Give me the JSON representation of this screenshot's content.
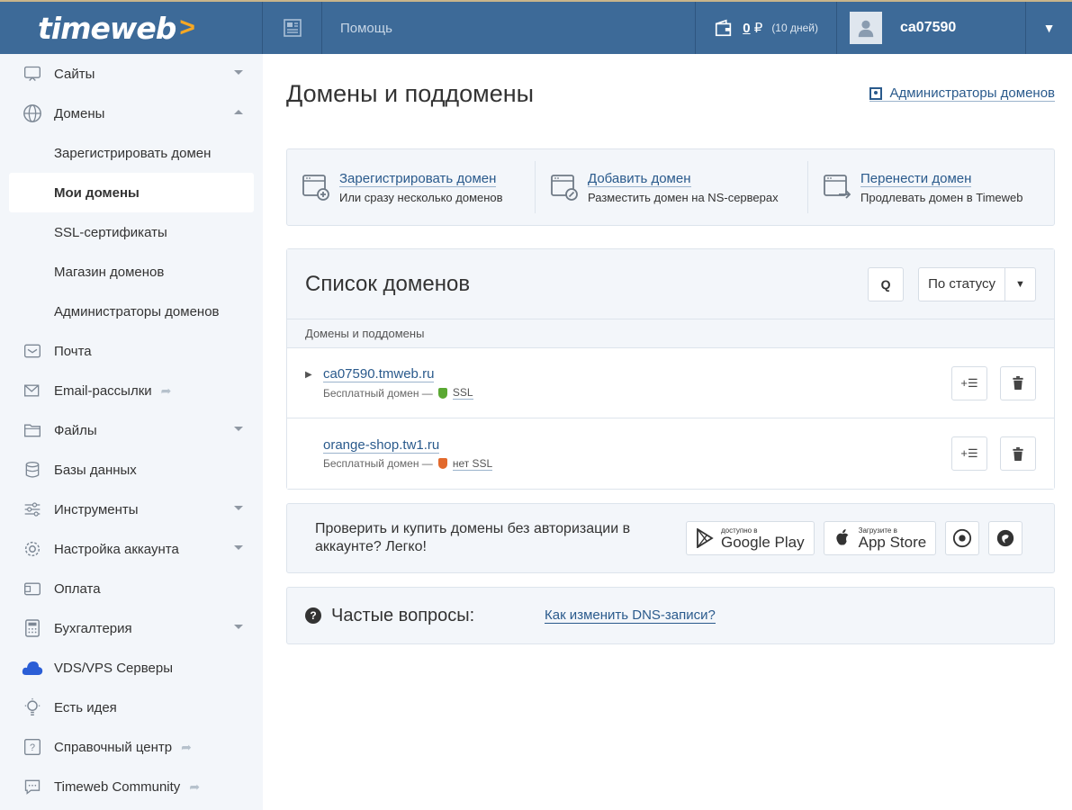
{
  "header": {
    "logo": "timeweb",
    "logo_arrow": ">",
    "help": "Помощь",
    "balance_amount": "0",
    "currency": "₽",
    "balance_days": "(10 дней)",
    "username": "ca07590"
  },
  "sidebar": {
    "items": [
      {
        "label": "Сайты",
        "icon": "monitor-icon"
      },
      {
        "label": "Домены",
        "icon": "globe-icon"
      },
      {
        "label": "Почта",
        "icon": "mail-icon"
      },
      {
        "label": "Email-рассылки",
        "icon": "envelope-icon"
      },
      {
        "label": "Файлы",
        "icon": "folder-icon"
      },
      {
        "label": "Базы данных",
        "icon": "database-icon"
      },
      {
        "label": "Инструменты",
        "icon": "sliders-icon"
      },
      {
        "label": "Настройка аккаунта",
        "icon": "gear-icon"
      },
      {
        "label": "Оплата",
        "icon": "wallet-icon"
      },
      {
        "label": "Бухгалтерия",
        "icon": "calculator-icon"
      },
      {
        "label": "VDS/VPS Серверы",
        "icon": "cloud-icon"
      },
      {
        "label": "Есть идея",
        "icon": "lightbulb-icon"
      },
      {
        "label": "Справочный центр",
        "icon": "question-icon"
      },
      {
        "label": "Timeweb Community",
        "icon": "chat-icon"
      }
    ],
    "domain_sub": [
      "Зарегистрировать домен",
      "Мои домены",
      "SSL-сертификаты",
      "Магазин доменов",
      "Администраторы доменов"
    ]
  },
  "main": {
    "title": "Домены и поддомены",
    "admins_link": "Администраторы доменов",
    "actions": [
      {
        "title": "Зарегистрировать домен",
        "subtitle": "Или сразу несколько доменов"
      },
      {
        "title": "Добавить домен",
        "subtitle": "Разместить домен на NS-серверах"
      },
      {
        "title": "Перенести домен",
        "subtitle": "Продлевать домен в Timeweb"
      }
    ],
    "list": {
      "title": "Список доменов",
      "search_label": "Q",
      "filter_value": "По статусу",
      "column_header": "Домены и поддомены",
      "rows": [
        {
          "name": "ca07590.tmweb.ru",
          "type": "Бесплатный домен —",
          "ssl": "SSL",
          "ssl_color": "#5aa832"
        },
        {
          "name": "orange-shop.tw1.ru",
          "type": "Бесплатный домен —",
          "ssl": "нет SSL",
          "ssl_color": "#e2692c"
        }
      ]
    },
    "apps": {
      "text": "Проверить и купить домены без авторизации в аккаунте? Легко!",
      "google_small": "доступно в",
      "google_big": "Google Play",
      "apple_small": "Загрузите в",
      "apple_big": "App Store"
    },
    "faq": {
      "label": "Частые вопросы:",
      "link": "Как изменить DNS-записи?"
    }
  },
  "colors": {
    "header_bg": "#3d6a98",
    "link": "#2a5a8c",
    "logo_accent": "#f7a823"
  }
}
